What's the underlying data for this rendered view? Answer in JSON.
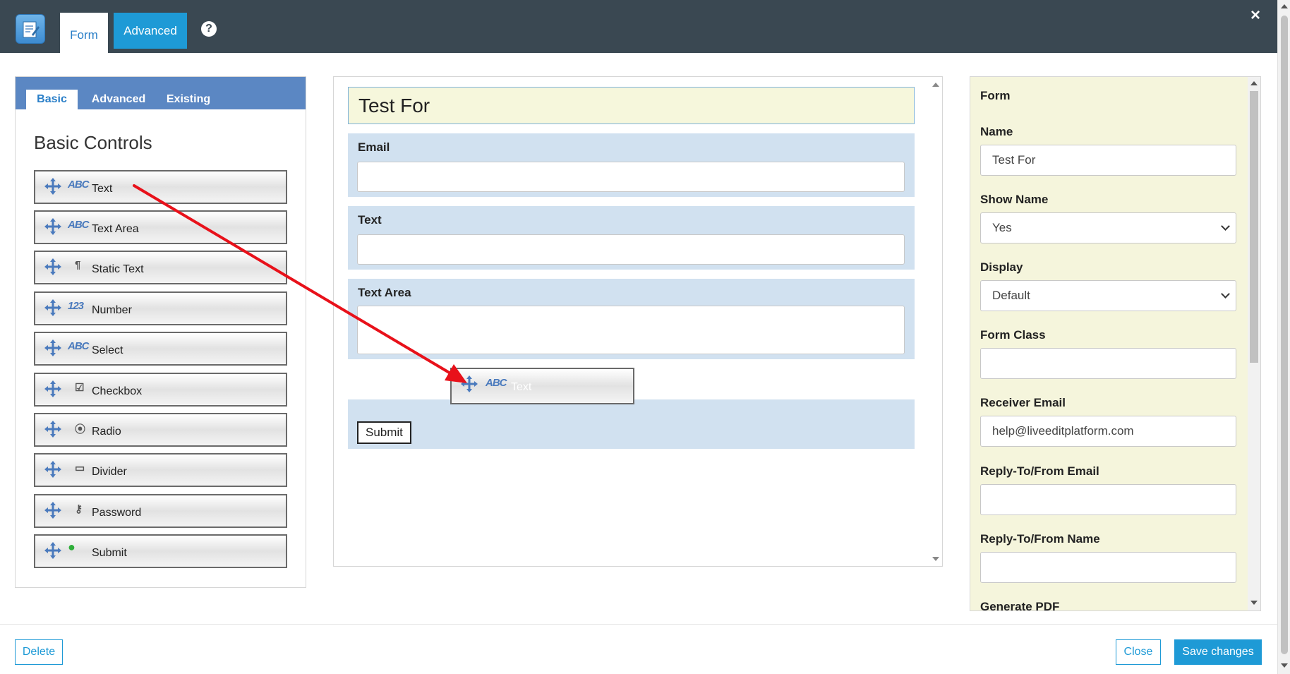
{
  "header": {
    "tabs": [
      {
        "label": "Form",
        "active": true
      },
      {
        "label": "Advanced",
        "active": false
      }
    ],
    "help_icon": "?",
    "close_icon": "×"
  },
  "left_panel": {
    "tabs": [
      {
        "label": "Basic",
        "active": true
      },
      {
        "label": "Advanced",
        "active": false
      },
      {
        "label": "Existing",
        "active": false
      }
    ],
    "title": "Basic Controls",
    "controls": [
      {
        "icon": "abc-icon",
        "glyph": "ABC",
        "label": "Text"
      },
      {
        "icon": "abc-icon",
        "glyph": "ABC",
        "label": "Text Area"
      },
      {
        "icon": "pilcrow-icon",
        "glyph": "¶",
        "label": "Static Text"
      },
      {
        "icon": "number-icon",
        "glyph": "123",
        "label": "Number"
      },
      {
        "icon": "abc-icon",
        "glyph": "ABC",
        "label": "Select"
      },
      {
        "icon": "checkbox-icon",
        "glyph": "☑",
        "label": "Checkbox"
      },
      {
        "icon": "radio-icon",
        "glyph": "⦿",
        "label": "Radio"
      },
      {
        "icon": "divider-icon",
        "glyph": "▭",
        "label": "Divider"
      },
      {
        "icon": "key-icon",
        "glyph": "⚷",
        "label": "Password"
      },
      {
        "icon": "green-circle-icon",
        "glyph": "●",
        "label": "Submit"
      }
    ]
  },
  "canvas": {
    "form_title": "Test For",
    "fields": [
      {
        "label": "Email",
        "value": ""
      },
      {
        "label": "Text",
        "value": ""
      },
      {
        "label": "Text Area",
        "value": ""
      }
    ],
    "submit_label": "Submit",
    "drag_ghost": {
      "glyph": "ABC",
      "label": "Text"
    }
  },
  "properties": {
    "heading": "Form",
    "name_label": "Name",
    "name_value": "Test For",
    "show_name_label": "Show Name",
    "show_name_value": "Yes",
    "display_label": "Display",
    "display_value": "Default",
    "form_class_label": "Form Class",
    "form_class_value": "",
    "receiver_email_label": "Receiver Email",
    "receiver_email_value": "help@liveeditplatform.com",
    "reply_email_label": "Reply-To/From Email",
    "reply_email_value": "",
    "reply_name_label": "Reply-To/From Name",
    "reply_name_value": "",
    "generate_pdf_label": "Generate PDF"
  },
  "footer": {
    "delete_label": "Delete",
    "close_label": "Close",
    "save_label": "Save changes"
  },
  "colors": {
    "header_bg": "#3a4852",
    "accent": "#1e9ad6",
    "field_block_bg": "#d1e1f0",
    "properties_bg": "#f5f5dc",
    "annotation_arrow": "#e8111a"
  }
}
